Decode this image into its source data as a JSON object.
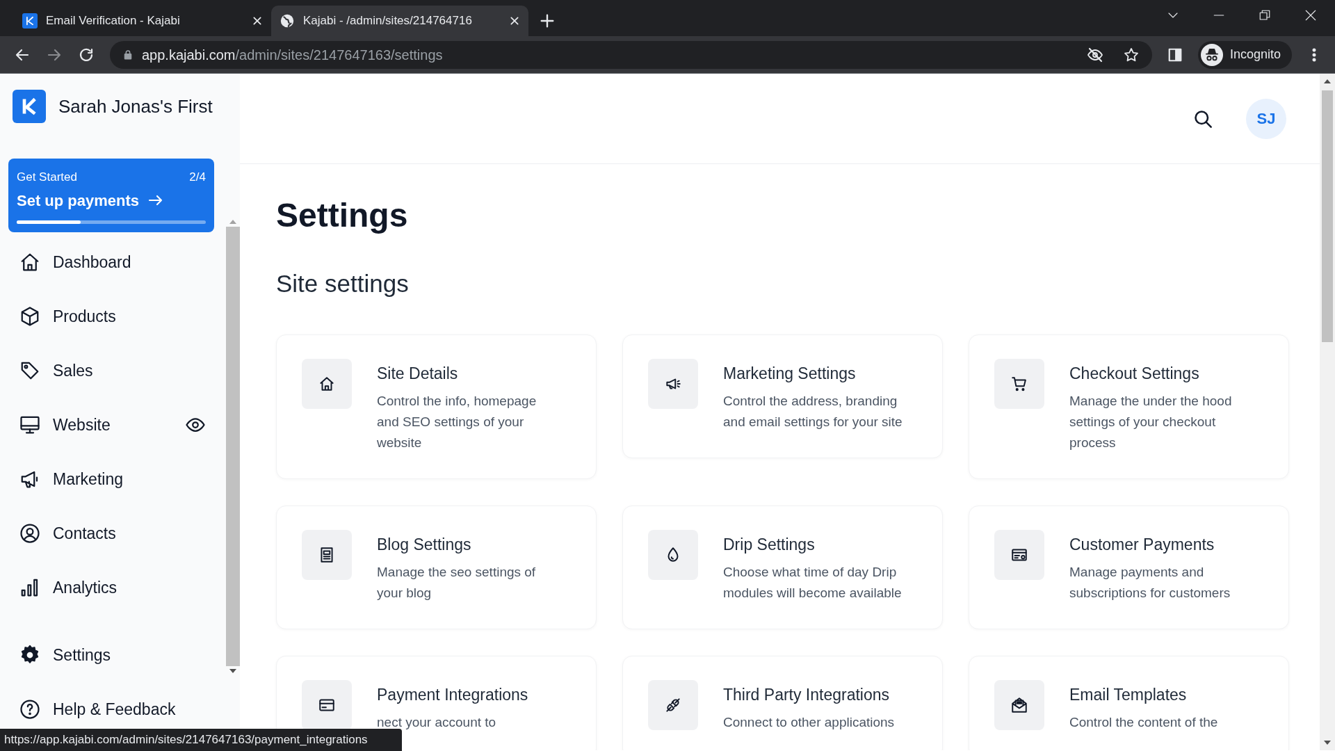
{
  "browser": {
    "tabs": [
      {
        "title": "Email Verification - Kajabi",
        "selected": false
      },
      {
        "title": "Kajabi - /admin/sites/214764716",
        "selected": true
      }
    ],
    "address": {
      "host": "app.kajabi.com",
      "path": "/admin/sites/2147647163/settings"
    },
    "profile": "Incognito"
  },
  "sidebar": {
    "brand": "Sarah Jonas's First",
    "get_started": {
      "label": "Get Started",
      "count": "2/4",
      "action": "Set up payments",
      "level": 0.34
    },
    "items": [
      {
        "label": "Dashboard"
      },
      {
        "label": "Products"
      },
      {
        "label": "Sales"
      },
      {
        "label": "Website"
      },
      {
        "label": "Marketing"
      },
      {
        "label": "Contacts"
      },
      {
        "label": "Analytics"
      }
    ],
    "footer_items": [
      {
        "label": "Settings"
      },
      {
        "label": "Help & Feedback"
      }
    ]
  },
  "header": {
    "avatar": "SJ"
  },
  "page": {
    "title": "Settings",
    "section": "Site settings",
    "cards": [
      {
        "title": "Site Details",
        "description": "Control the info, homepage and SEO settings of your website"
      },
      {
        "title": "Marketing Settings",
        "description": "Control the address, branding and email settings for your site"
      },
      {
        "title": "Checkout Settings",
        "description": "Manage the under the hood settings of your checkout process"
      },
      {
        "title": "Blog Settings",
        "description": "Manage the seo settings of your blog"
      },
      {
        "title": "Drip Settings",
        "description": "Choose what time of day Drip modules will become available"
      },
      {
        "title": "Customer Payments",
        "description": "Manage payments and subscriptions for customers"
      },
      {
        "title": "Payment Integrations",
        "description": "nect your account to"
      },
      {
        "title": "Third Party Integrations",
        "description": "Connect to other applications"
      },
      {
        "title": "Email Templates",
        "description": "Control the content of the"
      }
    ]
  },
  "status_url": "https://app.kajabi.com/admin/sites/2147647163/payment_integrations"
}
